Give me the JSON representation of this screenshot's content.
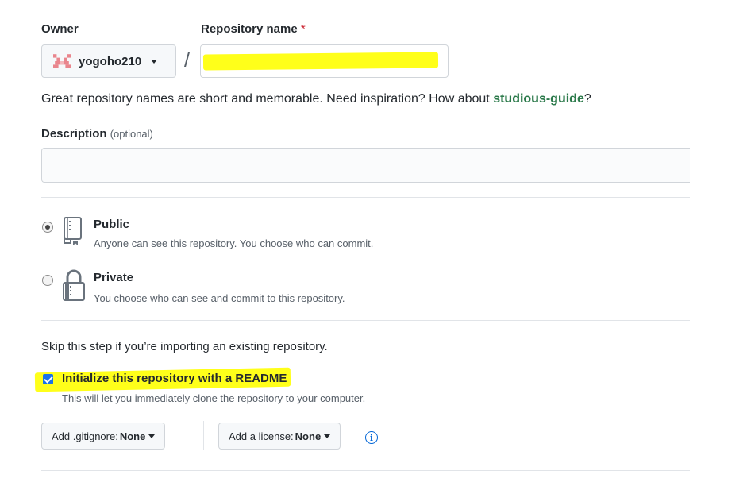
{
  "owner": {
    "label": "Owner",
    "username": "yogoho210"
  },
  "repository": {
    "label": "Repository name",
    "required_mark": "*",
    "value": "",
    "separator": "/"
  },
  "hint": {
    "text": "Great repository names are short and memorable. Need inspiration? How about ",
    "suggestion": "studious-guide",
    "suffix": "?"
  },
  "description": {
    "label": "Description",
    "optional": "(optional)",
    "value": ""
  },
  "visibility": {
    "selected": "public",
    "options": [
      {
        "id": "public",
        "title": "Public",
        "description": "Anyone can see this repository. You choose who can commit.",
        "icon": "repo-book-icon"
      },
      {
        "id": "private",
        "title": "Private",
        "description": "You choose who can see and commit to this repository.",
        "icon": "lock-icon"
      }
    ]
  },
  "init": {
    "skip_text": "Skip this step if you’re importing an existing repository.",
    "readme_label": "Initialize this repository with a README",
    "readme_desc": "This will let you immediately clone the repository to your computer.",
    "readme_checked": true
  },
  "dropdowns": {
    "gitignore_prefix": "Add .gitignore:",
    "gitignore_value": "None",
    "license_prefix": "Add a license:",
    "license_value": "None",
    "info_glyph": "i"
  },
  "colors": {
    "highlight": "#ffff1a",
    "suggestion": "#2c7a4b",
    "link": "#0366d6",
    "required": "#cb2431"
  }
}
